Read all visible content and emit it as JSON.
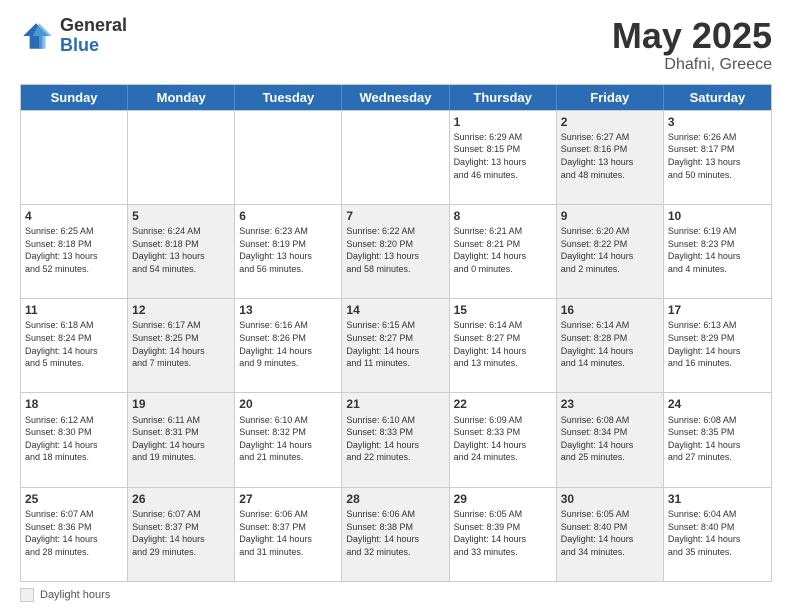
{
  "logo": {
    "general": "General",
    "blue": "Blue"
  },
  "title": {
    "month": "May 2025",
    "location": "Dhafni, Greece"
  },
  "days_of_week": [
    "Sunday",
    "Monday",
    "Tuesday",
    "Wednesday",
    "Thursday",
    "Friday",
    "Saturday"
  ],
  "footer": {
    "label": "Daylight hours"
  },
  "weeks": [
    [
      {
        "day": "",
        "content": "",
        "shaded": false
      },
      {
        "day": "",
        "content": "",
        "shaded": false
      },
      {
        "day": "",
        "content": "",
        "shaded": false
      },
      {
        "day": "",
        "content": "",
        "shaded": false
      },
      {
        "day": "1",
        "content": "Sunrise: 6:29 AM\nSunset: 8:15 PM\nDaylight: 13 hours\nand 46 minutes.",
        "shaded": false
      },
      {
        "day": "2",
        "content": "Sunrise: 6:27 AM\nSunset: 8:16 PM\nDaylight: 13 hours\nand 48 minutes.",
        "shaded": true
      },
      {
        "day": "3",
        "content": "Sunrise: 6:26 AM\nSunset: 8:17 PM\nDaylight: 13 hours\nand 50 minutes.",
        "shaded": false
      }
    ],
    [
      {
        "day": "4",
        "content": "Sunrise: 6:25 AM\nSunset: 8:18 PM\nDaylight: 13 hours\nand 52 minutes.",
        "shaded": false
      },
      {
        "day": "5",
        "content": "Sunrise: 6:24 AM\nSunset: 8:18 PM\nDaylight: 13 hours\nand 54 minutes.",
        "shaded": true
      },
      {
        "day": "6",
        "content": "Sunrise: 6:23 AM\nSunset: 8:19 PM\nDaylight: 13 hours\nand 56 minutes.",
        "shaded": false
      },
      {
        "day": "7",
        "content": "Sunrise: 6:22 AM\nSunset: 8:20 PM\nDaylight: 13 hours\nand 58 minutes.",
        "shaded": true
      },
      {
        "day": "8",
        "content": "Sunrise: 6:21 AM\nSunset: 8:21 PM\nDaylight: 14 hours\nand 0 minutes.",
        "shaded": false
      },
      {
        "day": "9",
        "content": "Sunrise: 6:20 AM\nSunset: 8:22 PM\nDaylight: 14 hours\nand 2 minutes.",
        "shaded": true
      },
      {
        "day": "10",
        "content": "Sunrise: 6:19 AM\nSunset: 8:23 PM\nDaylight: 14 hours\nand 4 minutes.",
        "shaded": false
      }
    ],
    [
      {
        "day": "11",
        "content": "Sunrise: 6:18 AM\nSunset: 8:24 PM\nDaylight: 14 hours\nand 5 minutes.",
        "shaded": false
      },
      {
        "day": "12",
        "content": "Sunrise: 6:17 AM\nSunset: 8:25 PM\nDaylight: 14 hours\nand 7 minutes.",
        "shaded": true
      },
      {
        "day": "13",
        "content": "Sunrise: 6:16 AM\nSunset: 8:26 PM\nDaylight: 14 hours\nand 9 minutes.",
        "shaded": false
      },
      {
        "day": "14",
        "content": "Sunrise: 6:15 AM\nSunset: 8:27 PM\nDaylight: 14 hours\nand 11 minutes.",
        "shaded": true
      },
      {
        "day": "15",
        "content": "Sunrise: 6:14 AM\nSunset: 8:27 PM\nDaylight: 14 hours\nand 13 minutes.",
        "shaded": false
      },
      {
        "day": "16",
        "content": "Sunrise: 6:14 AM\nSunset: 8:28 PM\nDaylight: 14 hours\nand 14 minutes.",
        "shaded": true
      },
      {
        "day": "17",
        "content": "Sunrise: 6:13 AM\nSunset: 8:29 PM\nDaylight: 14 hours\nand 16 minutes.",
        "shaded": false
      }
    ],
    [
      {
        "day": "18",
        "content": "Sunrise: 6:12 AM\nSunset: 8:30 PM\nDaylight: 14 hours\nand 18 minutes.",
        "shaded": false
      },
      {
        "day": "19",
        "content": "Sunrise: 6:11 AM\nSunset: 8:31 PM\nDaylight: 14 hours\nand 19 minutes.",
        "shaded": true
      },
      {
        "day": "20",
        "content": "Sunrise: 6:10 AM\nSunset: 8:32 PM\nDaylight: 14 hours\nand 21 minutes.",
        "shaded": false
      },
      {
        "day": "21",
        "content": "Sunrise: 6:10 AM\nSunset: 8:33 PM\nDaylight: 14 hours\nand 22 minutes.",
        "shaded": true
      },
      {
        "day": "22",
        "content": "Sunrise: 6:09 AM\nSunset: 8:33 PM\nDaylight: 14 hours\nand 24 minutes.",
        "shaded": false
      },
      {
        "day": "23",
        "content": "Sunrise: 6:08 AM\nSunset: 8:34 PM\nDaylight: 14 hours\nand 25 minutes.",
        "shaded": true
      },
      {
        "day": "24",
        "content": "Sunrise: 6:08 AM\nSunset: 8:35 PM\nDaylight: 14 hours\nand 27 minutes.",
        "shaded": false
      }
    ],
    [
      {
        "day": "25",
        "content": "Sunrise: 6:07 AM\nSunset: 8:36 PM\nDaylight: 14 hours\nand 28 minutes.",
        "shaded": false
      },
      {
        "day": "26",
        "content": "Sunrise: 6:07 AM\nSunset: 8:37 PM\nDaylight: 14 hours\nand 29 minutes.",
        "shaded": true
      },
      {
        "day": "27",
        "content": "Sunrise: 6:06 AM\nSunset: 8:37 PM\nDaylight: 14 hours\nand 31 minutes.",
        "shaded": false
      },
      {
        "day": "28",
        "content": "Sunrise: 6:06 AM\nSunset: 8:38 PM\nDaylight: 14 hours\nand 32 minutes.",
        "shaded": true
      },
      {
        "day": "29",
        "content": "Sunrise: 6:05 AM\nSunset: 8:39 PM\nDaylight: 14 hours\nand 33 minutes.",
        "shaded": false
      },
      {
        "day": "30",
        "content": "Sunrise: 6:05 AM\nSunset: 8:40 PM\nDaylight: 14 hours\nand 34 minutes.",
        "shaded": true
      },
      {
        "day": "31",
        "content": "Sunrise: 6:04 AM\nSunset: 8:40 PM\nDaylight: 14 hours\nand 35 minutes.",
        "shaded": false
      }
    ]
  ]
}
